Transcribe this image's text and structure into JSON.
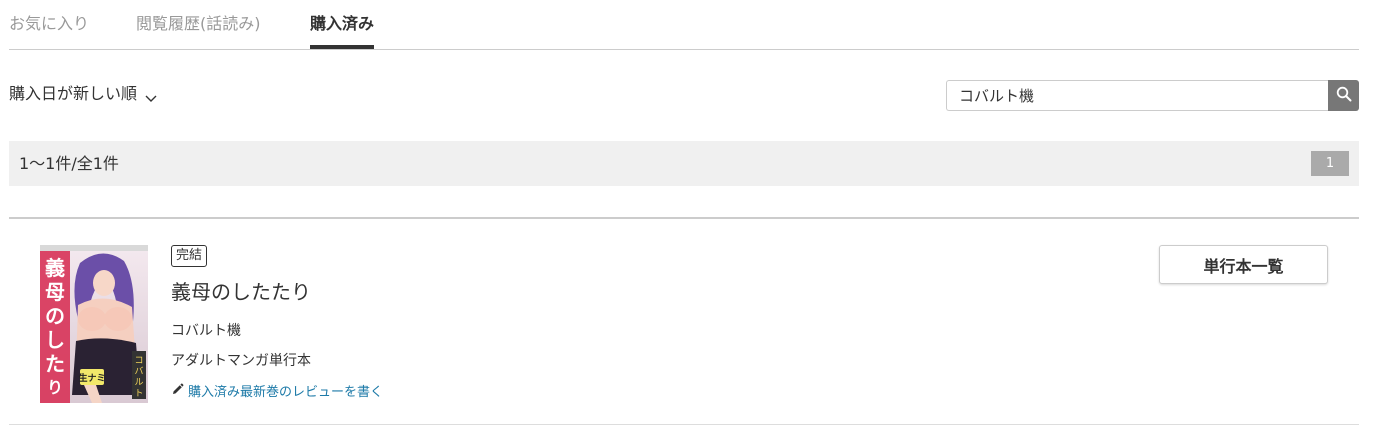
{
  "tabs": [
    {
      "label": "お気に入り"
    },
    {
      "label": "閲覧履歴(話読み)"
    },
    {
      "label": "購入済み"
    }
  ],
  "sort": {
    "label": "購入日が新しい順",
    "icon": "chevron-down-icon"
  },
  "search": {
    "value": "コバルト機",
    "icon": "search-icon"
  },
  "results": {
    "count_text": "1〜1件/全1件",
    "page": "1"
  },
  "item": {
    "badge": "完結",
    "title": "義母のしたたり",
    "author": "コバルト機",
    "genre": "アダルトマンガ単行本",
    "review_link": "購入済み最新巻のレビューを書く",
    "volumes_button": "単行本一覧",
    "cover_text": "義母のしたたり…",
    "cover_label": "生ナミ",
    "cover_author": "コバルト機"
  },
  "colors": {
    "accent_link": "#1d7aa8",
    "active_tab": "#333333",
    "inactive_tab": "#999999",
    "search_button": "#777777"
  }
}
